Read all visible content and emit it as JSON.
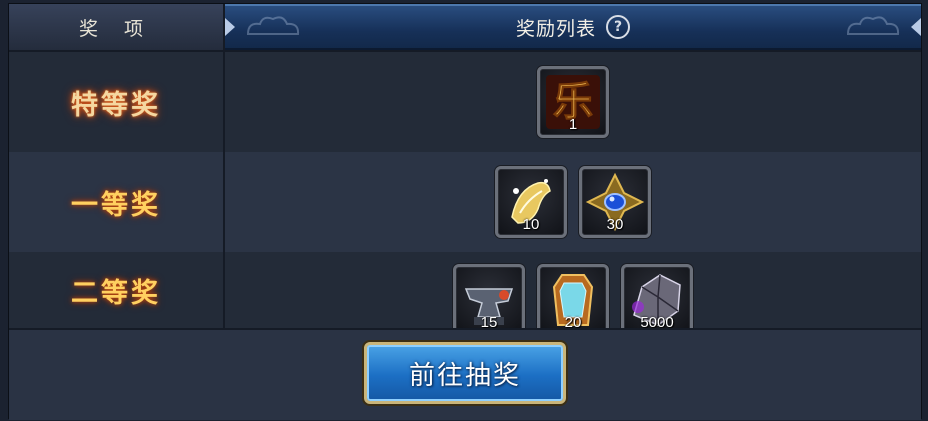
{
  "header": {
    "col_prize": "奖 项",
    "col_rewards": "奖励列表",
    "help_symbol": "?"
  },
  "rows": [
    {
      "label": "特等奖",
      "items": [
        {
          "icon": "le-character-token-icon",
          "quantity": "1"
        }
      ]
    },
    {
      "label": "一等奖",
      "items": [
        {
          "icon": "golden-scroll-icon",
          "quantity": "10"
        },
        {
          "icon": "sapphire-emblem-icon",
          "quantity": "30"
        }
      ]
    },
    {
      "label": "二等奖",
      "items": [
        {
          "icon": "anvil-icon",
          "quantity": "15"
        },
        {
          "icon": "mirror-talisman-icon",
          "quantity": "20"
        },
        {
          "icon": "purple-ore-icon",
          "quantity": "5000"
        }
      ]
    }
  ],
  "footer": {
    "draw_button_label": "前往抽奖"
  },
  "colors": {
    "header_blue": "#163058",
    "button_blue": "#1c6fc4",
    "button_border_gold": "#c9b57a"
  }
}
